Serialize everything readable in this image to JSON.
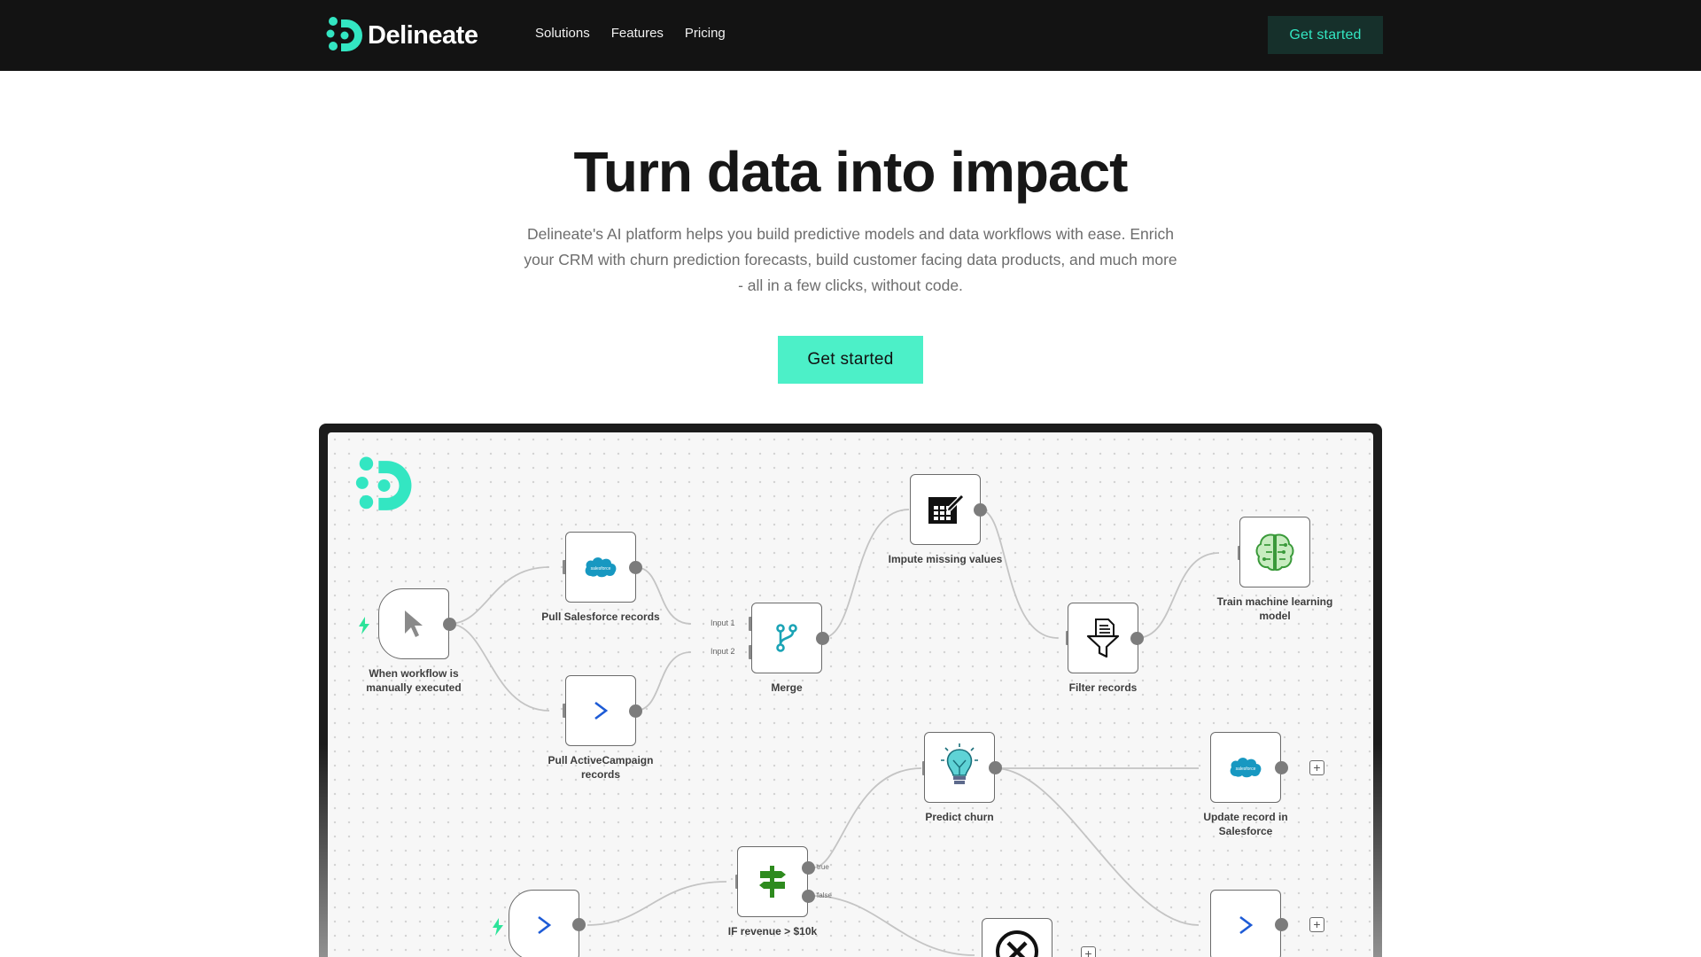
{
  "nav": {
    "brand": "Delineate",
    "links": [
      "Solutions",
      "Features",
      "Pricing"
    ],
    "cta": "Get started"
  },
  "hero": {
    "title": "Turn data into impact",
    "subtitle_lines": [
      "Delineate's AI platform helps you build predictive models and data workflows with ease. Enrich",
      "your CRM with churn prediction forecasts, build customer facing data products, and much more",
      "- all in a few clicks, without code."
    ],
    "cta": "Get started"
  },
  "workflow": {
    "nodes": {
      "trigger1": {
        "label_lines": [
          "When workflow is",
          "manually executed"
        ],
        "icon": "cursor-icon"
      },
      "salesforce": {
        "label_lines": [
          "Pull Salesforce records"
        ],
        "icon": "salesforce-icon"
      },
      "activecampaign": {
        "label_lines": [
          "Pull ActiveCampaign",
          "records"
        ],
        "icon": "activecampaign-icon"
      },
      "merge": {
        "label_lines": [
          "Merge"
        ],
        "icon": "merge-icon",
        "inputs": [
          "Input 1",
          "Input 2"
        ]
      },
      "impute": {
        "label_lines": [
          "Impute missing values"
        ],
        "icon": "spreadsheet-edit-icon"
      },
      "filter": {
        "label_lines": [
          "Filter records"
        ],
        "icon": "filter-icon"
      },
      "train": {
        "label_lines": [
          "Train machine learning",
          "model"
        ],
        "icon": "brain-icon"
      },
      "predict": {
        "label_lines": [
          "Predict churn"
        ],
        "icon": "lightbulb-icon"
      },
      "update": {
        "label_lines": [
          "Update record in",
          "Salesforce"
        ],
        "icon": "salesforce-icon"
      },
      "ifrev": {
        "label_lines": [
          "IF revenue > $10k"
        ],
        "icon": "signpost-icon",
        "outputs": [
          "true",
          "false"
        ]
      },
      "trigger2": {
        "label_lines": [],
        "icon": "activecampaign-icon"
      },
      "stop": {
        "label_lines": [],
        "icon": "stop-icon"
      },
      "ac_out": {
        "label_lines": [],
        "icon": "activecampaign-icon"
      }
    },
    "colors": {
      "accent": "#33e6c2",
      "lightning": "#2de39a",
      "salesforce": "#1798c1",
      "activecampaign": "#1d5bd6"
    }
  }
}
